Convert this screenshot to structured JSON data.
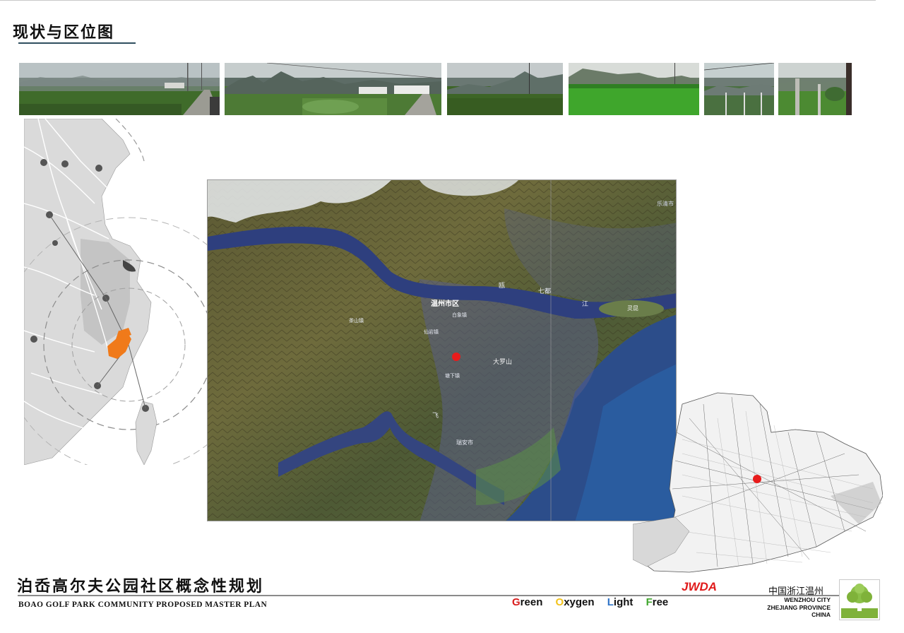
{
  "header": {
    "title": "现状与区位图"
  },
  "photos": [
    {
      "name": "farmland-road",
      "colors": {
        "sky": "#b9c2c4",
        "mountain": "#7d8a86",
        "field": "#3f6b2a"
      }
    },
    {
      "name": "village-valley",
      "colors": {
        "sky": "#c6cdcd",
        "mountain": "#5d6c66",
        "field": "#4d7a35"
      }
    },
    {
      "name": "mountain-fields",
      "colors": {
        "sky": "#c4cacb",
        "mountain": "#6a7873",
        "field": "#3d6526"
      }
    },
    {
      "name": "rice-paddy",
      "colors": {
        "sky": "#d8dcd8",
        "mountain": "#6f7f6e",
        "field": "#3fa62c"
      }
    },
    {
      "name": "fence-field",
      "colors": {
        "sky": "#c5cfcf",
        "mountain": "#6e7c76",
        "field": "#4a7040"
      }
    },
    {
      "name": "orchard-posts",
      "colors": {
        "sky": "#cdd3d1",
        "mountain": "#6f7f70",
        "field": "#4c8a32"
      }
    }
  ],
  "satellite": {
    "labels": {
      "city_district": "温州市区",
      "river_ou": "瓯",
      "river_jiang": "江",
      "river_feiyun": "飞",
      "island": "灵昆",
      "north_town": "七都",
      "mountain": "大罗山",
      "ruian": "瑞安市",
      "town_1": "茶山镇",
      "town_2": "白象镇",
      "town_3": "仙岩镇",
      "town_4": "塘下镇",
      "yueqing": "乐清市"
    },
    "site_marker_color": "#e81c1c"
  },
  "site_map": {
    "site_marker_color": "#e81c1c"
  },
  "regional_map": {
    "highlight_color": "#f07a1a"
  },
  "footer": {
    "project_cn": "泊岙高尔夫公园社区概念性规划",
    "project_en": "BOAO GOLF PARK COMMUNITY PROPOSED MASTER PLAN",
    "brand": "JWDA",
    "slogan": [
      {
        "initial": "G",
        "rest": "reen",
        "color": "#d81c1c"
      },
      {
        "initial": "O",
        "rest": "xygen",
        "color": "#f2c21a"
      },
      {
        "initial": "L",
        "rest": "ight",
        "color": "#2f74c8"
      },
      {
        "initial": "F",
        "rest": "ree",
        "color": "#3fa62c"
      }
    ],
    "location_cn": "中国浙江温州",
    "location_en_1": "WENZHOU CITY",
    "location_en_2": "ZHEJIANG PROVINCE",
    "location_en_3": "CHINA",
    "logo_icon": "tree-icon"
  }
}
